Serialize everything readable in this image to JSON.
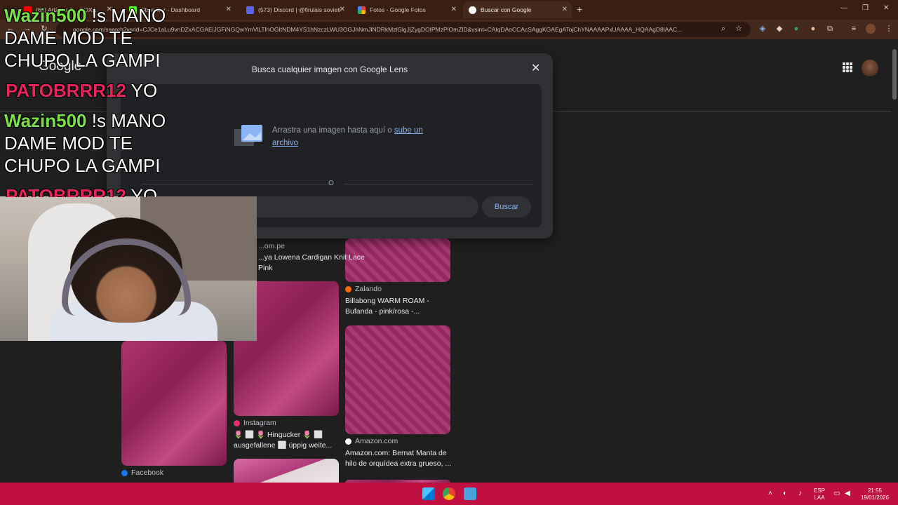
{
  "browser": {
    "tabs": [
      {
        "label": "(63) Arizona P...  ROXA",
        "color": "#ff0000"
      },
      {
        "label": "Streamer - Dashboard",
        "color": "#53fc18"
      },
      {
        "label": "(573) Discord | @firulais sovieti",
        "color": "#5865f2"
      },
      {
        "label": "Fotos - Google Fotos",
        "color": "#fbbc04"
      },
      {
        "label": "Buscar con Google",
        "color": "#8ab4f8"
      }
    ],
    "new_tab": "+",
    "url": "google.com/search?vsrid=CJCe1aLu9vnDZxACGAEiJGFiNGQwYmVlLTlhOGItNDM4YS1hNzczLWU3OGJhNmJlNDRkMzlGlgJjZygDOIPMzPiOmZlD&vsint=CAIqDAoCCAcSAggKGAEgATojChYNAAAAPxUAAAA_HQAAgD8lAAC...",
    "window_controls": {
      "minimize": "—",
      "restore": "❐",
      "close": "✕"
    }
  },
  "google": {
    "logo": "Google"
  },
  "lens": {
    "title": "Busca cualquier imagen con Google Lens",
    "drop_text": "Arrastra una imagen hasta aquí o ",
    "drop_link": "sube un archivo",
    "or": "O",
    "input_placeholder": "",
    "search_button": "Buscar"
  },
  "results": [
    {
      "source": "...om.pe",
      "caption": "...ya Lowena Cardigan Knit Lace Pink",
      "source_color": "#5f6368"
    },
    {
      "source": "Zalando",
      "caption": "Billabong WARM ROAM - Bufanda - pink/rosa -...",
      "source_color": "#ff6900"
    },
    {
      "source": "Instagram",
      "caption": "🌷 ⬜ 🌷 Hingucker 🌷 ⬜ ausgefallene ⬜ üppig weite...",
      "source_color": "#e1306c"
    },
    {
      "source": "Amazon.com",
      "caption": "Amazon.com: Bernat Manta de hilo de orquídea extra grueso, ...",
      "source_color": "#ffffff"
    },
    {
      "source": "Facebook",
      "caption": "",
      "source_color": "#1877f2"
    }
  ],
  "chat": [
    {
      "user": "Wazin500",
      "text": " !s MANO",
      "cont": [
        "DAME MOD TE",
        "CHUPO LA GAMPI"
      ],
      "user_color": "#7be04a"
    },
    {
      "user": "PATOBRRR12",
      "text": " YO",
      "cont": [],
      "user_color": "#e8245a"
    },
    {
      "user": "Wazin500",
      "text": " !s MANO",
      "cont": [
        "DAME MOD TE",
        "CHUPO LA GAMPI"
      ],
      "user_color": "#7be04a"
    },
    {
      "user": "PATOBRRR12",
      "text": " YO",
      "cont": [],
      "user_color": "#e8245a"
    }
  ],
  "taskbar": {
    "lang_top": "ESP",
    "lang_bottom": "LAA",
    "time": "21:55",
    "date": "19/01/2026"
  }
}
